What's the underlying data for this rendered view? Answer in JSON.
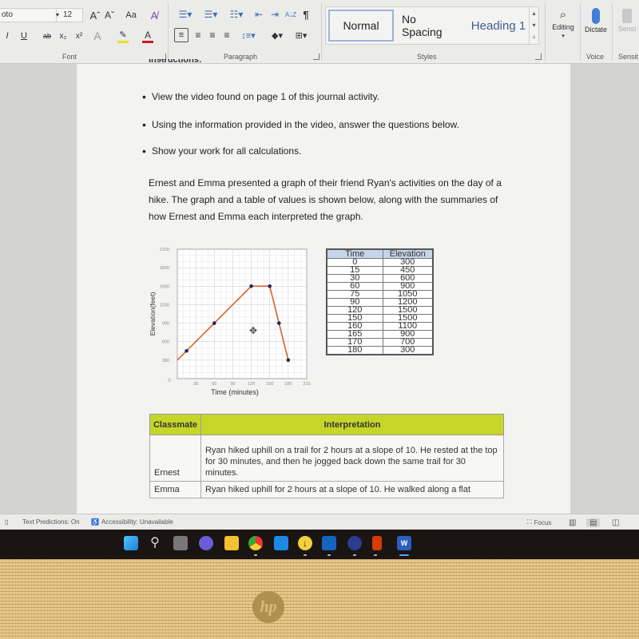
{
  "ribbon": {
    "font_name": "oto",
    "font_size": "12",
    "font_group_label": "Font",
    "paragraph_group_label": "Paragraph",
    "styles_group_label": "Styles",
    "voice_group_label": "Voice",
    "sensitivity_group_label": "Sensit",
    "styles": [
      "Normal",
      "No Spacing",
      "Heading 1"
    ],
    "editing_label": "Editing",
    "dictate_label": "Dictate",
    "sensitivity_label": "Sensi",
    "buttons": {
      "grow_font": "Aˆ",
      "shrink_font": "Aˇ",
      "change_case": "Aa",
      "clear_format": "A̸",
      "italic": "I",
      "underline": "U",
      "strikethrough": "ab",
      "subscript": "x₂",
      "superscript": "x²",
      "text_effects": "A",
      "highlight": "✎",
      "font_color": "A",
      "pilcrow": "¶",
      "sort": "A↓Z"
    },
    "colors": {
      "highlight": "#e8e020",
      "font_color": "#d01c1c",
      "dictate_mic": "#3f7fd6",
      "heading1": "#3f5f8f"
    }
  },
  "document": {
    "partial_heading": "Instructions:",
    "bullets": [
      "View the video found on page 1 of this journal activity.",
      "Using the information provided in the video, answer the questions below.",
      "Show your work for all calculations."
    ],
    "paragraph": "Ernest and Emma presented a graph of their friend Ryan's activities on the day of a hike. The graph and a table of values is shown below, along with the summaries of how Ernest and Emma each interpreted the graph.",
    "value_table": {
      "headers": [
        "Time",
        "Elevation"
      ],
      "rows": [
        [
          "0",
          "300"
        ],
        [
          "15",
          "450"
        ],
        [
          "30",
          "600"
        ],
        [
          "60",
          "900"
        ],
        [
          "75",
          "1050"
        ],
        [
          "90",
          "1200"
        ],
        [
          "120",
          "1500"
        ],
        [
          "150",
          "1500"
        ],
        [
          "160",
          "1100"
        ],
        [
          "165",
          "900"
        ],
        [
          "170",
          "700"
        ],
        [
          "180",
          "300"
        ]
      ]
    },
    "interpretation_table": {
      "headers": [
        "Classmate",
        "Interpretation"
      ],
      "rows": [
        [
          "Ernest",
          "Ryan hiked uphill on a trail for 2 hours at a slope of 10. He rested at the top for 30 minutes, and then he jogged back down the same trail for 30 minutes."
        ],
        [
          "Emma",
          "Ryan hiked uphill for 2 hours at a slope of 10. He walked along a flat"
        ]
      ],
      "header_color": "#c6d629"
    }
  },
  "chart_data": {
    "type": "line",
    "title": "",
    "xlabel": "Time (minutes)",
    "ylabel": "Elevation(feet)",
    "xlim": [
      0,
      210
    ],
    "ylim": [
      0,
      2100
    ],
    "x_ticks": [
      "0",
      "30",
      "60",
      "90",
      "120",
      "150",
      "180",
      "210"
    ],
    "y_ticks": [
      "300",
      "600",
      "900",
      "1200",
      "1500",
      "1800",
      "2100"
    ],
    "grid": true,
    "line_color": "#d9622b",
    "marker_color": "#1f2a5a",
    "line_points": [
      [
        0,
        300
      ],
      [
        120,
        1500
      ],
      [
        150,
        1500
      ],
      [
        165,
        900
      ],
      [
        180,
        300
      ]
    ],
    "markers": [
      [
        15,
        450
      ],
      [
        60,
        900
      ],
      [
        120,
        1500
      ],
      [
        150,
        1500
      ],
      [
        165,
        900
      ],
      [
        180,
        300
      ]
    ]
  },
  "statusbar": {
    "text_predictions": "Text Predictions: On",
    "accessibility": "Accessibility: Unavailable",
    "focus": "Focus"
  },
  "taskbar": {
    "apps": [
      "start",
      "search",
      "task-view",
      "teams-chat",
      "file-explorer",
      "chrome",
      "mail",
      "downloader",
      "outlook",
      "app-circle",
      "office",
      "word"
    ]
  },
  "bezel": {
    "brand": "hp"
  }
}
